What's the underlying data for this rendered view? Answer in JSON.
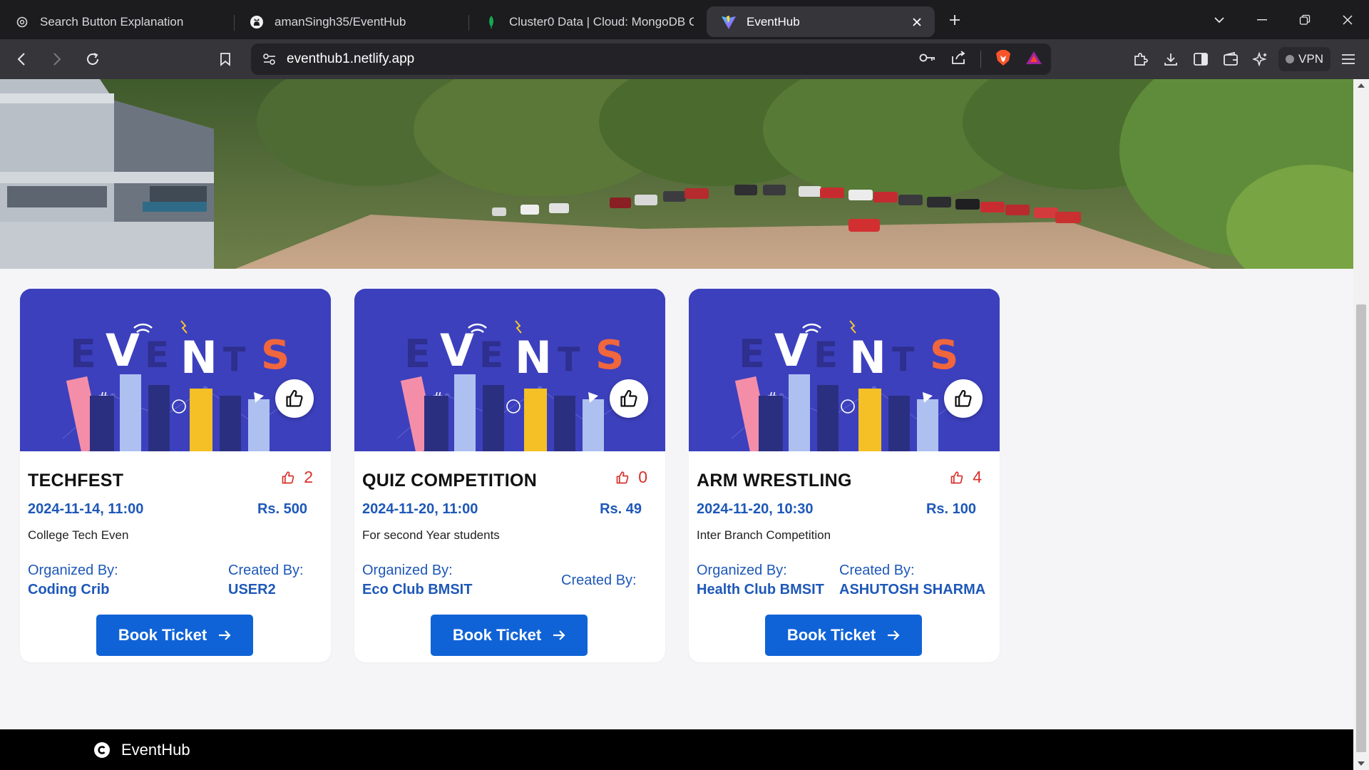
{
  "browser": {
    "tabs": [
      {
        "title": "Search Button Explanation",
        "icon": "openai-icon"
      },
      {
        "title": "amanSingh35/EventHub",
        "icon": "github-icon"
      },
      {
        "title": "Cluster0 Data | Cloud: MongoDB Cl",
        "icon": "mongodb-leaf-icon"
      },
      {
        "title": "EventHub",
        "icon": "vite-icon",
        "active": true
      }
    ],
    "url": "eventhub1.netlify.app",
    "vpn_label": "VPN"
  },
  "events": [
    {
      "title": "TECHFEST",
      "likes": "2",
      "datetime": "2024-11-14, 11:00",
      "price": "Rs. 500",
      "description": "College Tech Even",
      "organized_label": "Organized By:",
      "organizer": "Coding Crib",
      "created_label": "Created By:",
      "creator": "USER2",
      "book_label": "Book Ticket"
    },
    {
      "title": "QUIZ COMPETITION",
      "likes": "0",
      "datetime": "2024-11-20, 11:00",
      "price": "Rs. 49",
      "description": "For second Year students",
      "organized_label": "Organized By:",
      "organizer": "Eco Club BMSIT",
      "created_label": "Created By:",
      "creator": "",
      "book_label": "Book Ticket"
    },
    {
      "title": "ARM WRESTLING",
      "likes": "4",
      "datetime": "2024-11-20, 10:30",
      "price": "Rs. 100",
      "description": "Inter Branch Competition",
      "organized_label": "Organized By:",
      "organizer": "Health Club BMSIT",
      "created_label": "Created By:",
      "creator": "ASHUTOSH SHARMA",
      "book_label": "Book Ticket"
    }
  ],
  "footer": {
    "brand": "EventHub"
  },
  "colors": {
    "accent": "#1063d6",
    "banner": "#3c40bd",
    "like": "#d8302c",
    "link_text": "#1e58b8"
  }
}
